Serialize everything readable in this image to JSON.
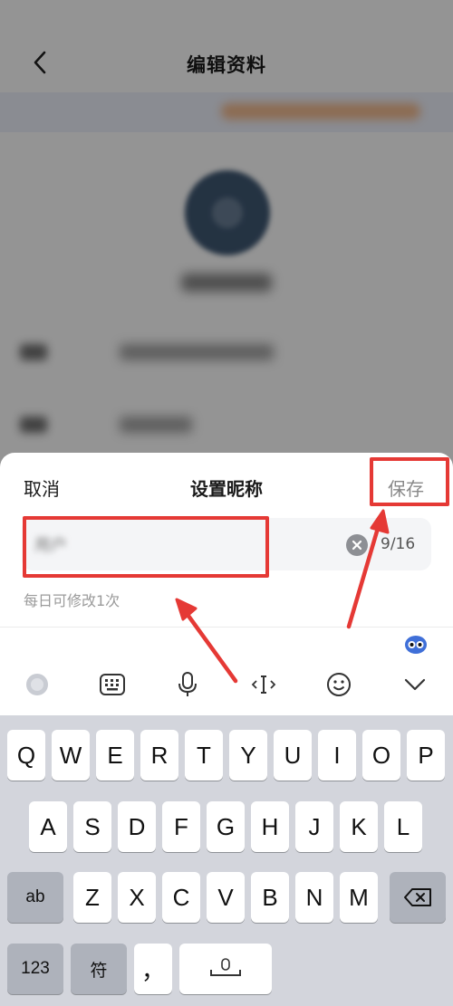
{
  "header": {
    "title": "编辑资料"
  },
  "background": {
    "notice_blurred": "",
    "avatar_caption_blurred": "",
    "rows": [
      {
        "label": "",
        "value": ""
      },
      {
        "label": "",
        "value": ""
      }
    ]
  },
  "sheet": {
    "cancel_label": "取消",
    "title": "设置昵称",
    "save_label": "保存",
    "nickname_value": "用户            ",
    "counter": "9/16",
    "hint": "每日可修改1次"
  },
  "keyboard": {
    "toolbar_icons": [
      "globe-icon",
      "keyboard-icon",
      "microphone-icon",
      "cursor-move-icon",
      "emoji-icon",
      "chevron-down-icon"
    ],
    "row1": [
      "Q",
      "W",
      "E",
      "R",
      "T",
      "Y",
      "U",
      "I",
      "O",
      "P"
    ],
    "row2": [
      "A",
      "S",
      "D",
      "F",
      "G",
      "H",
      "J",
      "K",
      "L"
    ],
    "row3": [
      "Z",
      "X",
      "C",
      "V",
      "B",
      "N",
      "M"
    ],
    "shift_label": "ab",
    "numbers_label": "123",
    "symbols_label": "符",
    "comma_label": "，"
  },
  "colors": {
    "highlight": "#e53935",
    "keyboard_bg": "#d3d5dc"
  }
}
